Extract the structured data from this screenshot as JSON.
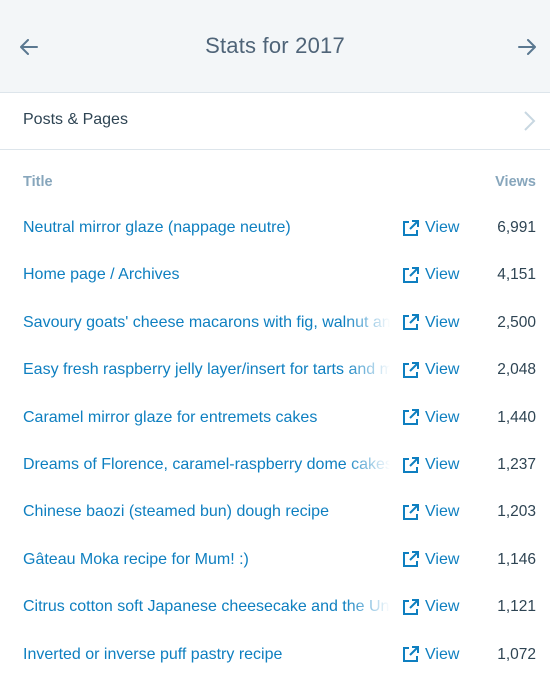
{
  "header": {
    "title": "Stats for 2017"
  },
  "section": {
    "label": "Posts & Pages"
  },
  "table": {
    "col_title": "Title",
    "col_views": "Views",
    "view_label": "View",
    "rows": [
      {
        "title": "Neutral mirror glaze (nappage neutre)",
        "views": "6,991"
      },
      {
        "title": "Home page / Archives",
        "views": "4,151"
      },
      {
        "title": "Savoury goats' cheese macarons with fig, walnut and honey",
        "views": "2,500"
      },
      {
        "title": "Easy fresh raspberry jelly layer/insert for tarts and more",
        "views": "2,048"
      },
      {
        "title": "Caramel mirror glaze for entremets cakes",
        "views": "1,440"
      },
      {
        "title": "Dreams of Florence, caramel-raspberry dome cakes",
        "views": "1,237"
      },
      {
        "title": "Chinese baozi (steamed bun) dough recipe",
        "views": "1,203"
      },
      {
        "title": "Gâteau Moka recipe for Mum! :)",
        "views": "1,146"
      },
      {
        "title": "Citrus cotton soft Japanese cheesecake and the Universe",
        "views": "1,121"
      },
      {
        "title": "Inverted or inverse puff pastry recipe",
        "views": "1,072"
      }
    ]
  },
  "colors": {
    "link": "#0e7fc0",
    "header_bg": "#f3f6f8",
    "muted": "#87a6bc"
  }
}
